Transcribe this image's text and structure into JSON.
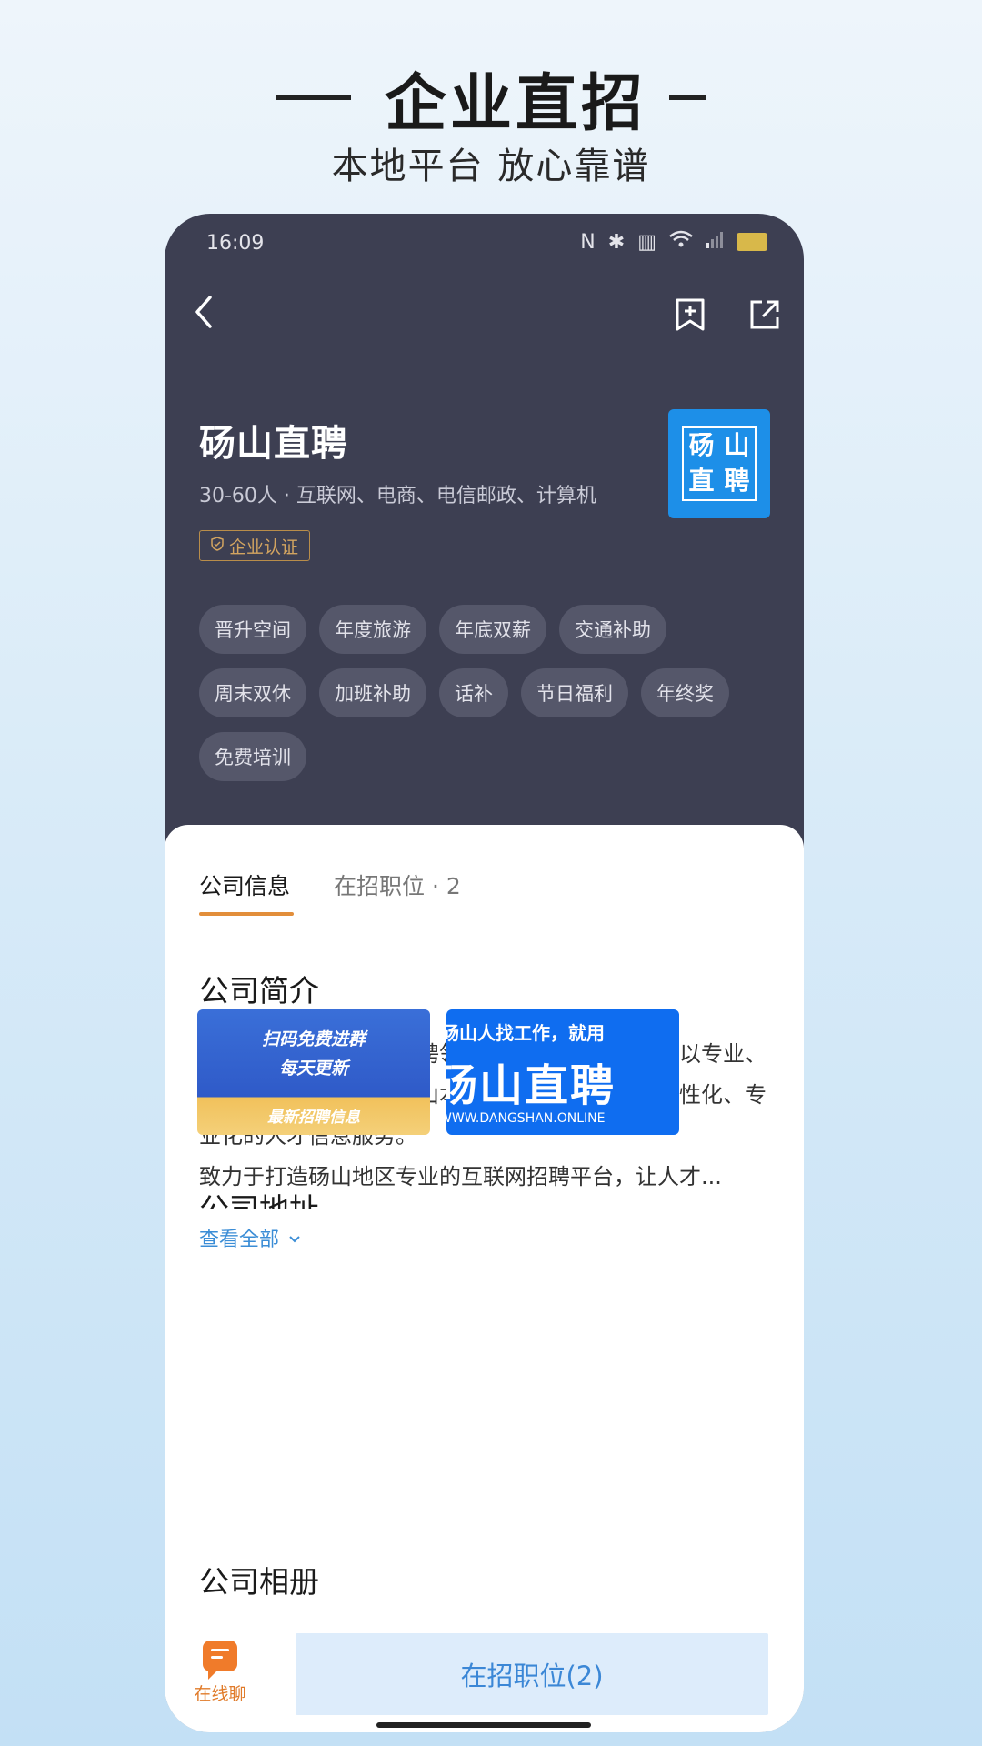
{
  "banner": {
    "title": "企业直招",
    "subtitle": "本地平台 放心靠谱"
  },
  "status_bar": {
    "time": "16:09",
    "icons": [
      "nfc-icon",
      "bluetooth-icon",
      "data-icon",
      "wifi-icon",
      "signal-icon",
      "battery-icon"
    ]
  },
  "nav": {
    "back_icon": "back-arrow-icon",
    "bookmark_icon": "bookmark-add-icon",
    "share_icon": "share-icon"
  },
  "company": {
    "name": "砀山直聘",
    "meta": "30-60人 · 互联网、电商、电信邮政、计算机",
    "cert_label": "企业认证",
    "logo_chars": [
      "砀",
      "山",
      "直",
      "聘"
    ]
  },
  "tags": [
    "晋升空间",
    "年度旅游",
    "年底双薪",
    "交通补助",
    "周末双休",
    "加班补助",
    "话补",
    "节日福利",
    "年终奖",
    "免费培训"
  ],
  "tabs": {
    "info": "公司信息",
    "jobs": "在招职位 · 2"
  },
  "intro": {
    "title": "公司简介",
    "paragraph1": "砀山直聘是专注人才招聘领域的互联网招聘平台，以专业、品质、有效为核心为砀山本地企业及求职者打造人性化、专业化的人才信息服务。",
    "paragraph2": "致力于打造砀山地区专业的互联网招聘平台，让人才...",
    "view_all": "查看全部"
  },
  "album": {
    "title": "公司相册",
    "photo1": {
      "line1": "扫码免费进群",
      "line2": "每天更新",
      "line3": "最新招聘信息"
    },
    "photo2": {
      "line1": "砀山人找工作，就用",
      "line2": "砀山直聘",
      "line3": "WWW.DANGSHAN.ONLINE"
    }
  },
  "address": {
    "title": "公司地址"
  },
  "bottom": {
    "chat_label": "在线聊",
    "jobs_button": "在招职位(2)"
  }
}
